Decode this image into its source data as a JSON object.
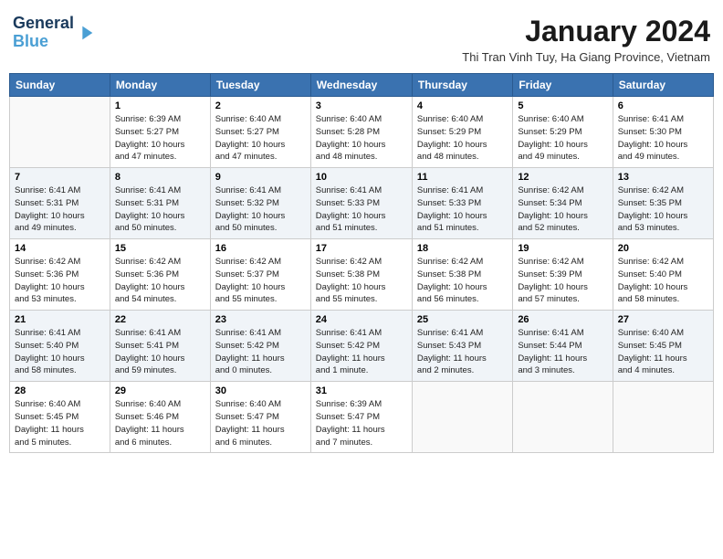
{
  "header": {
    "logo_line1": "General",
    "logo_line2": "Blue",
    "month_title": "January 2024",
    "subtitle": "Thi Tran Vinh Tuy, Ha Giang Province, Vietnam"
  },
  "days_of_week": [
    "Sunday",
    "Monday",
    "Tuesday",
    "Wednesday",
    "Thursday",
    "Friday",
    "Saturday"
  ],
  "weeks": [
    [
      {
        "day": "",
        "info": ""
      },
      {
        "day": "1",
        "info": "Sunrise: 6:39 AM\nSunset: 5:27 PM\nDaylight: 10 hours\nand 47 minutes."
      },
      {
        "day": "2",
        "info": "Sunrise: 6:40 AM\nSunset: 5:27 PM\nDaylight: 10 hours\nand 47 minutes."
      },
      {
        "day": "3",
        "info": "Sunrise: 6:40 AM\nSunset: 5:28 PM\nDaylight: 10 hours\nand 48 minutes."
      },
      {
        "day": "4",
        "info": "Sunrise: 6:40 AM\nSunset: 5:29 PM\nDaylight: 10 hours\nand 48 minutes."
      },
      {
        "day": "5",
        "info": "Sunrise: 6:40 AM\nSunset: 5:29 PM\nDaylight: 10 hours\nand 49 minutes."
      },
      {
        "day": "6",
        "info": "Sunrise: 6:41 AM\nSunset: 5:30 PM\nDaylight: 10 hours\nand 49 minutes."
      }
    ],
    [
      {
        "day": "7",
        "info": "Sunrise: 6:41 AM\nSunset: 5:31 PM\nDaylight: 10 hours\nand 49 minutes."
      },
      {
        "day": "8",
        "info": "Sunrise: 6:41 AM\nSunset: 5:31 PM\nDaylight: 10 hours\nand 50 minutes."
      },
      {
        "day": "9",
        "info": "Sunrise: 6:41 AM\nSunset: 5:32 PM\nDaylight: 10 hours\nand 50 minutes."
      },
      {
        "day": "10",
        "info": "Sunrise: 6:41 AM\nSunset: 5:33 PM\nDaylight: 10 hours\nand 51 minutes."
      },
      {
        "day": "11",
        "info": "Sunrise: 6:41 AM\nSunset: 5:33 PM\nDaylight: 10 hours\nand 51 minutes."
      },
      {
        "day": "12",
        "info": "Sunrise: 6:42 AM\nSunset: 5:34 PM\nDaylight: 10 hours\nand 52 minutes."
      },
      {
        "day": "13",
        "info": "Sunrise: 6:42 AM\nSunset: 5:35 PM\nDaylight: 10 hours\nand 53 minutes."
      }
    ],
    [
      {
        "day": "14",
        "info": "Sunrise: 6:42 AM\nSunset: 5:36 PM\nDaylight: 10 hours\nand 53 minutes."
      },
      {
        "day": "15",
        "info": "Sunrise: 6:42 AM\nSunset: 5:36 PM\nDaylight: 10 hours\nand 54 minutes."
      },
      {
        "day": "16",
        "info": "Sunrise: 6:42 AM\nSunset: 5:37 PM\nDaylight: 10 hours\nand 55 minutes."
      },
      {
        "day": "17",
        "info": "Sunrise: 6:42 AM\nSunset: 5:38 PM\nDaylight: 10 hours\nand 55 minutes."
      },
      {
        "day": "18",
        "info": "Sunrise: 6:42 AM\nSunset: 5:38 PM\nDaylight: 10 hours\nand 56 minutes."
      },
      {
        "day": "19",
        "info": "Sunrise: 6:42 AM\nSunset: 5:39 PM\nDaylight: 10 hours\nand 57 minutes."
      },
      {
        "day": "20",
        "info": "Sunrise: 6:42 AM\nSunset: 5:40 PM\nDaylight: 10 hours\nand 58 minutes."
      }
    ],
    [
      {
        "day": "21",
        "info": "Sunrise: 6:41 AM\nSunset: 5:40 PM\nDaylight: 10 hours\nand 58 minutes."
      },
      {
        "day": "22",
        "info": "Sunrise: 6:41 AM\nSunset: 5:41 PM\nDaylight: 10 hours\nand 59 minutes."
      },
      {
        "day": "23",
        "info": "Sunrise: 6:41 AM\nSunset: 5:42 PM\nDaylight: 11 hours\nand 0 minutes."
      },
      {
        "day": "24",
        "info": "Sunrise: 6:41 AM\nSunset: 5:42 PM\nDaylight: 11 hours\nand 1 minute."
      },
      {
        "day": "25",
        "info": "Sunrise: 6:41 AM\nSunset: 5:43 PM\nDaylight: 11 hours\nand 2 minutes."
      },
      {
        "day": "26",
        "info": "Sunrise: 6:41 AM\nSunset: 5:44 PM\nDaylight: 11 hours\nand 3 minutes."
      },
      {
        "day": "27",
        "info": "Sunrise: 6:40 AM\nSunset: 5:45 PM\nDaylight: 11 hours\nand 4 minutes."
      }
    ],
    [
      {
        "day": "28",
        "info": "Sunrise: 6:40 AM\nSunset: 5:45 PM\nDaylight: 11 hours\nand 5 minutes."
      },
      {
        "day": "29",
        "info": "Sunrise: 6:40 AM\nSunset: 5:46 PM\nDaylight: 11 hours\nand 6 minutes."
      },
      {
        "day": "30",
        "info": "Sunrise: 6:40 AM\nSunset: 5:47 PM\nDaylight: 11 hours\nand 6 minutes."
      },
      {
        "day": "31",
        "info": "Sunrise: 6:39 AM\nSunset: 5:47 PM\nDaylight: 11 hours\nand 7 minutes."
      },
      {
        "day": "",
        "info": ""
      },
      {
        "day": "",
        "info": ""
      },
      {
        "day": "",
        "info": ""
      }
    ]
  ]
}
